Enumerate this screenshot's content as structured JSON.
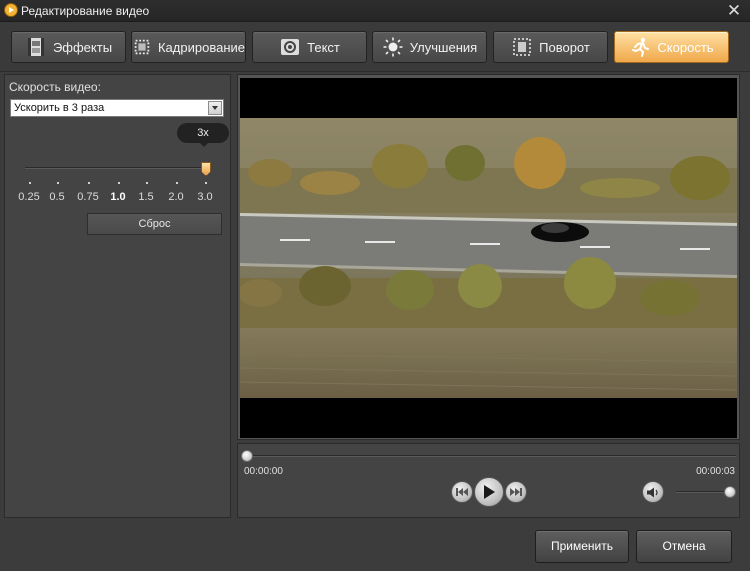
{
  "window": {
    "title": "Редактирование видео",
    "close_glyph": "✕"
  },
  "tabs": [
    {
      "label": "Эффекты",
      "icon": "film-effects-icon"
    },
    {
      "label": "Кадрирование",
      "icon": "crop-icon"
    },
    {
      "label": "Текст",
      "icon": "text-icon"
    },
    {
      "label": "Улучшения",
      "icon": "brightness-icon"
    },
    {
      "label": "Поворот",
      "icon": "rotate-icon"
    },
    {
      "label": "Скорость",
      "icon": "running-man-icon",
      "active": true
    }
  ],
  "speed": {
    "label": "Скорость видео:",
    "selected": "Ускорить в 3 раза",
    "bubble": "3x",
    "ticks": [
      "0.25",
      "0.5",
      "0.75",
      "1.0",
      "1.5",
      "2.0",
      "3.0"
    ],
    "current_value": "3.0",
    "reset_label": "Сброс"
  },
  "player": {
    "time_start": "00:00:00",
    "time_end": "00:00:03",
    "position_fraction": 0.0,
    "volume_fraction": 1.0
  },
  "footer": {
    "apply_label": "Применить",
    "cancel_label": "Отмена"
  },
  "colors": {
    "active_tab": "#f0a84a",
    "background": "#3c3c3c"
  }
}
